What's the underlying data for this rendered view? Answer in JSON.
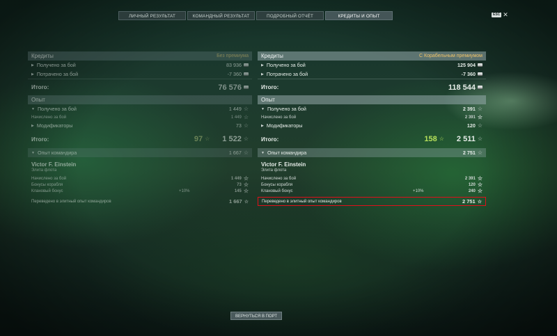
{
  "tabs": [
    {
      "label": "ЛИЧНЫЙ РЕЗУЛЬТАТ"
    },
    {
      "label": "КОМАНДНЫЙ РЕЗУЛЬТАТ"
    },
    {
      "label": "ПОДРОБНЫЙ ОТЧЁТ"
    },
    {
      "label": "КРЕДИТЫ И ОПЫТ"
    }
  ],
  "esc": {
    "key": "ESC",
    "close": "✕"
  },
  "left": {
    "credits": {
      "title": "Кредиты",
      "premium": "Без премиума",
      "earned_label": "Получено за бой",
      "earned_value": "83 936",
      "spent_label": "Потрачено за бой",
      "spent_value": "-7 360",
      "total_label": "Итого:",
      "total_value": "76 576"
    },
    "exp": {
      "title": "Опыт",
      "earned_label": "Получено за бой",
      "earned_value": "1 449",
      "accrued_label": "Начислено за бой",
      "accrued_value": "1 449",
      "modifiers_label": "Модификаторы",
      "modifiers_value": "73",
      "total_label": "Итого:",
      "total_free": "97",
      "total_value": "1 522",
      "cmdr_exp_label": "Опыт командира",
      "cmdr_exp_value": "1 667"
    },
    "commander": {
      "name": "Victor F. Einstein",
      "rank": "Элита флота",
      "rows": [
        {
          "label": "Начислено за бой",
          "mid": "",
          "value": "1 449"
        },
        {
          "label": "Бонусы корабля",
          "mid": "",
          "value": "73"
        },
        {
          "label": "Клановый бонус",
          "mid": "+10%",
          "value": "145"
        }
      ],
      "elite_label": "Переведено в элитный опыт командиров",
      "elite_value": "1 667"
    }
  },
  "right": {
    "credits": {
      "title": "Кредиты",
      "premium": "С Корабельным премиумом",
      "earned_label": "Получено за бой",
      "earned_value": "125 904",
      "spent_label": "Потрачено за бой",
      "spent_value": "-7 360",
      "total_label": "Итого:",
      "total_value": "118 544"
    },
    "exp": {
      "title": "Опыт",
      "earned_label": "Получено за бой",
      "earned_value": "2 391",
      "accrued_label": "Начислено за бой",
      "accrued_value": "2 391",
      "modifiers_label": "Модификаторы",
      "modifiers_value": "120",
      "total_label": "Итого:",
      "total_free": "158",
      "total_value": "2 511",
      "cmdr_exp_label": "Опыт командира",
      "cmdr_exp_value": "2 751"
    },
    "commander": {
      "name": "Victor F. Einstein",
      "rank": "Элита флота",
      "rows": [
        {
          "label": "Начислено за бой",
          "mid": "",
          "value": "2 391"
        },
        {
          "label": "Бонусы корабля",
          "mid": "",
          "value": "120"
        },
        {
          "label": "Клановый бонус",
          "mid": "+10%",
          "value": "240"
        }
      ],
      "elite_label": "Переведено в элитный опыт командиров",
      "elite_value": "2 751"
    }
  },
  "back_button": "ВЕРНУТЬСЯ В ПОРТ",
  "colors": {
    "highlight": "#e0101a",
    "premium": "#f0c36a",
    "free_exp": "#b6e05a"
  }
}
